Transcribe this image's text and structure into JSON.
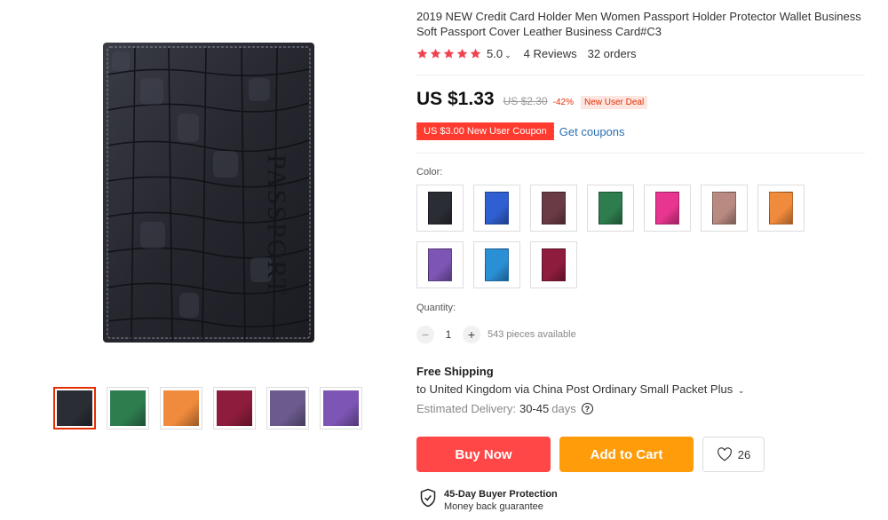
{
  "product": {
    "title": "2019 NEW Credit Card Holder Men Women Passport Holder Protector Wallet Business Soft Passport Cover Leather Business Card#C3",
    "main_image_text": "PASSPORT",
    "main_image_icon": "passport-cover-image"
  },
  "rating": {
    "stars": 5,
    "score": "5.0",
    "reviews": "4 Reviews",
    "orders": "32 orders",
    "star_color": "#f0424f"
  },
  "price": {
    "current": "US $1.33",
    "original": "US $2.30",
    "discount": "-42%",
    "deal": "New User Deal"
  },
  "coupon": {
    "label": "US $3.00 New User Coupon",
    "link": "Get coupons"
  },
  "color": {
    "label": "Color:",
    "swatches": [
      "#2b2d35",
      "#2f5fd0",
      "#6b3b45",
      "#2e7d4f",
      "#e8358f",
      "#b98a82",
      "#f08a3c",
      "#7d55b5",
      "#2b8fd6",
      "#8e1c3c"
    ]
  },
  "thumbnails": [
    "#2b2d35",
    "#2e7d4f",
    "#f08a3c",
    "#8e1c3c",
    "#6b5a8e",
    "#7d55b5"
  ],
  "quantity": {
    "label": "Quantity:",
    "value": "1",
    "available": "543 pieces available"
  },
  "shipping": {
    "title": "Free Shipping",
    "to": "to United Kingdom via China Post Ordinary Small Packet Plus",
    "eta_label": "Estimated Delivery:",
    "eta_value": "30-45",
    "eta_unit": "days"
  },
  "actions": {
    "buy": "Buy Now",
    "cart": "Add to Cart",
    "wishlist_count": "26",
    "buy_color": "#ff4747",
    "cart_color": "#ff9c0a"
  },
  "protection": {
    "title": "45-Day Buyer Protection",
    "subtitle": "Money back guarantee"
  }
}
